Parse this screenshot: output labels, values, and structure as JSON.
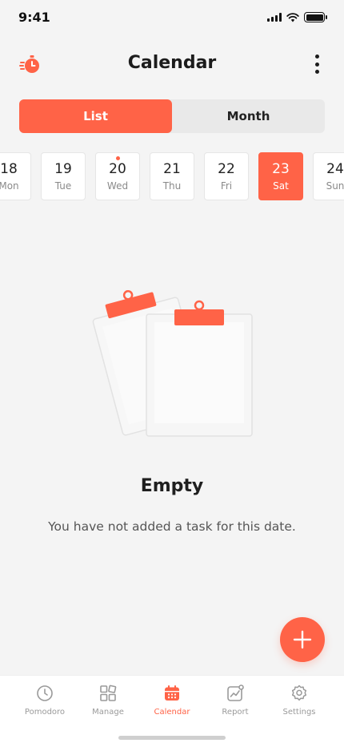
{
  "status_bar": {
    "time": "9:41"
  },
  "header": {
    "title": "Calendar",
    "logo_icon": "timer-icon",
    "menu_icon": "more-vertical-icon"
  },
  "view_toggle": {
    "options": [
      "List",
      "Month"
    ],
    "selected": "List"
  },
  "dates": [
    {
      "num": "18",
      "day": "Mon",
      "has_task": false,
      "selected": false
    },
    {
      "num": "19",
      "day": "Tue",
      "has_task": false,
      "selected": false
    },
    {
      "num": "20",
      "day": "Wed",
      "has_task": true,
      "selected": false
    },
    {
      "num": "21",
      "day": "Thu",
      "has_task": false,
      "selected": false
    },
    {
      "num": "22",
      "day": "Fri",
      "has_task": false,
      "selected": false
    },
    {
      "num": "23",
      "day": "Sat",
      "has_task": false,
      "selected": true
    },
    {
      "num": "24",
      "day": "Sun",
      "has_task": false,
      "selected": false
    }
  ],
  "empty_state": {
    "title": "Empty",
    "message": "You have not added a task for this date."
  },
  "fab": {
    "icon": "plus-icon"
  },
  "bottom_nav": {
    "items": [
      {
        "label": "Pomodoro",
        "icon": "clock-icon",
        "active": false
      },
      {
        "label": "Manage",
        "icon": "grid-icon",
        "active": false
      },
      {
        "label": "Calendar",
        "icon": "calendar-icon",
        "active": true
      },
      {
        "label": "Report",
        "icon": "chart-icon",
        "active": false
      },
      {
        "label": "Settings",
        "icon": "gear-icon",
        "active": false
      }
    ]
  },
  "colors": {
    "accent": "#ff6347",
    "background": "#f4f4f4",
    "muted": "#9a9a9a"
  }
}
